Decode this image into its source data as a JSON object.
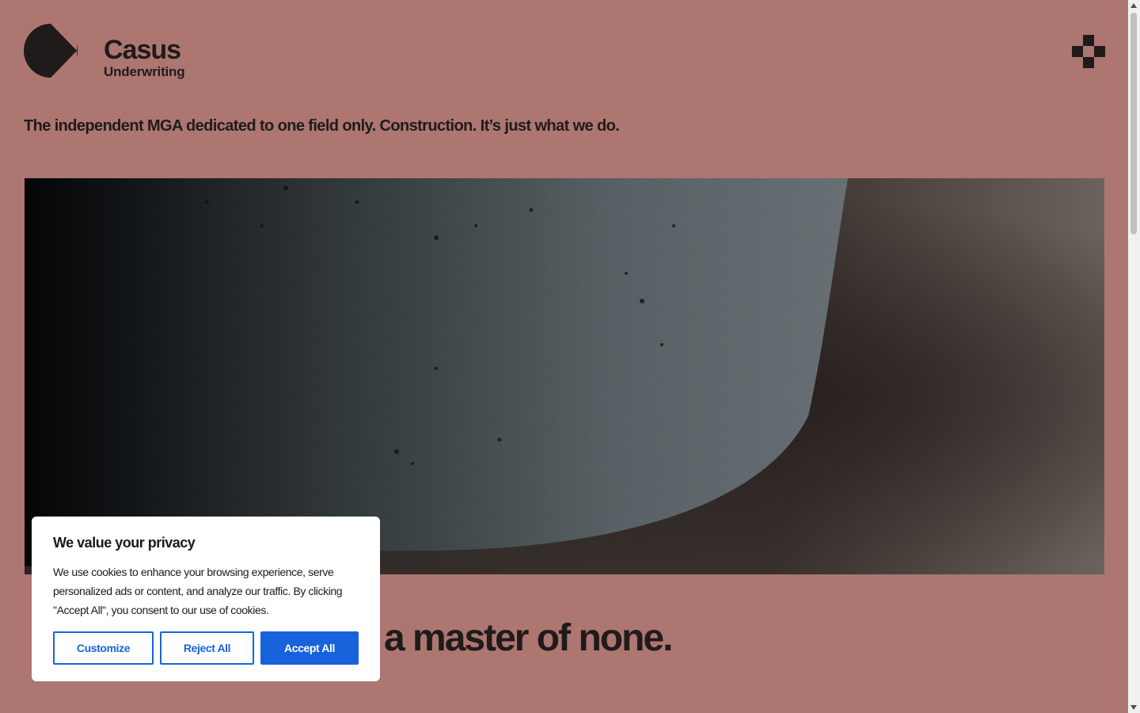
{
  "brand": {
    "name": "Casus",
    "sub": "Underwriting"
  },
  "header": {
    "menu_icon": "plus-cross-icon"
  },
  "tagline": "The independent MGA dedicated to one field only. Construction. It’s just what we do.",
  "hero": {
    "image": "concrete-texture-closeup"
  },
  "headline": "a master of none.",
  "cookie": {
    "title": "We value your privacy",
    "text": "We use cookies to enhance your browsing experience, serve personalized ads or content, and analyze our traffic. By clicking \"Accept All\", you consent to our use of cookies.",
    "customize": "Customize",
    "reject": "Reject All",
    "accept": "Accept All"
  },
  "colors": {
    "background": "#ad7670",
    "ink": "#1f1b1b",
    "accent": "#1863dc"
  }
}
